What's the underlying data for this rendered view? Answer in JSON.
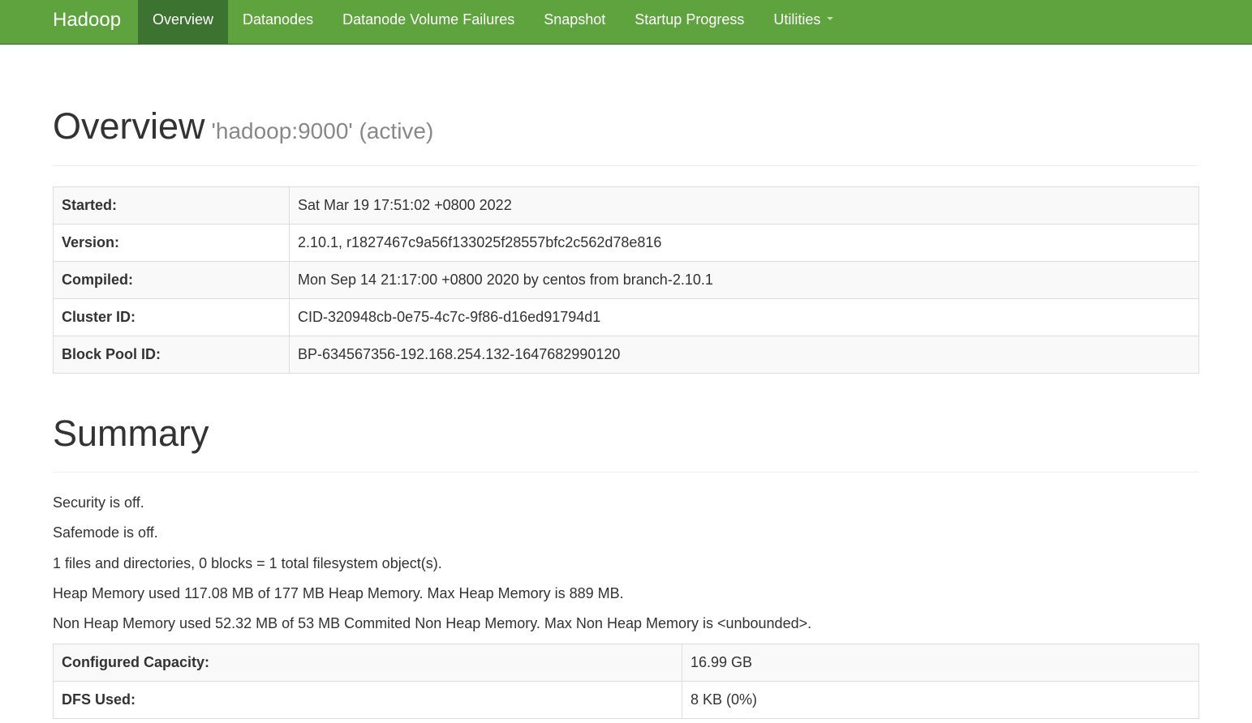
{
  "navbar": {
    "brand": "Hadoop",
    "items": [
      {
        "label": "Overview",
        "active": true
      },
      {
        "label": "Datanodes"
      },
      {
        "label": "Datanode Volume Failures"
      },
      {
        "label": "Snapshot"
      },
      {
        "label": "Startup Progress"
      },
      {
        "label": "Utilities",
        "dropdown": true
      }
    ],
    "colors": {
      "background": "#5fa33e",
      "active": "#3d7330"
    }
  },
  "overview": {
    "title": "Overview",
    "subtitle": "'hadoop:9000' (active)",
    "rows": [
      {
        "key": "Started:",
        "value": "Sat Mar 19 17:51:02 +0800 2022"
      },
      {
        "key": "Version:",
        "value": "2.10.1, r1827467c9a56f133025f28557bfc2c562d78e816"
      },
      {
        "key": "Compiled:",
        "value": "Mon Sep 14 21:17:00 +0800 2020 by centos from branch-2.10.1"
      },
      {
        "key": "Cluster ID:",
        "value": "CID-320948cb-0e75-4c7c-9f86-d16ed91794d1"
      },
      {
        "key": "Block Pool ID:",
        "value": "BP-634567356-192.168.254.132-1647682990120"
      }
    ]
  },
  "summary": {
    "title": "Summary",
    "lines": [
      "Security is off.",
      "Safemode is off.",
      "1 files and directories, 0 blocks = 1 total filesystem object(s).",
      "Heap Memory used 117.08 MB of 177 MB Heap Memory. Max Heap Memory is 889 MB.",
      "Non Heap Memory used 52.32 MB of 53 MB Commited Non Heap Memory. Max Non Heap Memory is <unbounded>."
    ],
    "rows": [
      {
        "key": "Configured Capacity:",
        "value": "16.99 GB"
      },
      {
        "key": "DFS Used:",
        "value": "8 KB (0%)"
      }
    ]
  }
}
